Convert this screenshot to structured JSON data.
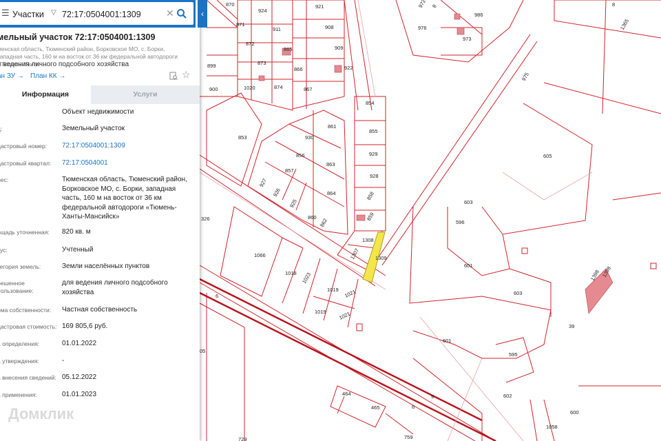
{
  "search": {
    "menu_icon": "menu-icon",
    "type": "Участки",
    "value": "72:17:0504001:1309",
    "clear_icon": "close-icon",
    "search_icon": "search-icon",
    "collapse": "‹"
  },
  "card": {
    "title": "мельный участок 72:17:0504001:1309",
    "address_short": "менская область, Тюменский район, Борковское МО, с. Борки, западная часть, 160 м на восток от 36 км федеральной автодороги «Тюмень-Ханты-...",
    "purpose": "я ведения личного подсобного хозяйства",
    "link_zu": "ан ЗУ →",
    "link_kk": "План КК →"
  },
  "tabs": {
    "info": "Информация",
    "services": "Услуги"
  },
  "rows": [
    {
      "label": ":",
      "value": "Объект недвижимости"
    },
    {
      "label": "д:",
      "value": "Земельный участок"
    },
    {
      "label": "дастровый номер:",
      "value": "72:17:0504001:1309"
    },
    {
      "label": "дастровый квартал:",
      "value": "72:17:0504001"
    },
    {
      "label": "рес:",
      "value": "Тюменская область, Тюменский район, Борковское МО, с. Борки, западная часть, 160 м на восток от 36 км федеральной автодороги «Тюмень-Ханты-Мансийск»"
    },
    {
      "label": "ощадь уточненная:",
      "value": "820 кв. м"
    },
    {
      "label": "тус:",
      "value": "Учтенный"
    },
    {
      "label": "тегория земель:",
      "value": "Земли населённых пунктов"
    },
    {
      "label": "решенное",
      "label2": "пользование:",
      "value": "для ведения личного подсобного хозяйства"
    },
    {
      "label": "рма собственности:",
      "value": "Частная собственность"
    },
    {
      "label": "дастровая стоимость:",
      "value": "169 805,6 руб."
    },
    {
      "label": "а определения:",
      "value": "01.01.2022"
    },
    {
      "label": "а утверждения:",
      "value": "-"
    },
    {
      "label": "а внесения сведений:",
      "value": "05.12.2022"
    },
    {
      "label": "а применения:",
      "value": "01.01.2023"
    }
  ],
  "watermark": "Домклик",
  "map_labels": [
    "870",
    "924",
    "921",
    "871",
    "911",
    "908",
    "872",
    "865",
    "909",
    "899",
    "873",
    "866",
    "922",
    "874",
    "867",
    "900",
    "1020",
    "854",
    "853",
    "861",
    "855",
    "930",
    "929",
    "856",
    "863",
    "928",
    "857",
    "927",
    "926",
    "864",
    "925",
    "858",
    "860",
    "859",
    "862",
    "326",
    "1308",
    "1309",
    "1307",
    "1066",
    "1018",
    "1023",
    "1019",
    "1021",
    "1019",
    "1021",
    "6",
    "05",
    "464",
    "465",
    "6",
    "9",
    "729",
    "759",
    "1058",
    "600",
    "602",
    "601",
    "603",
    "39",
    "595",
    "601",
    "596",
    "603",
    "605",
    "975",
    "986",
    "976",
    "973",
    "972",
    "8",
    "8",
    "1365",
    "1398",
    "1398"
  ]
}
